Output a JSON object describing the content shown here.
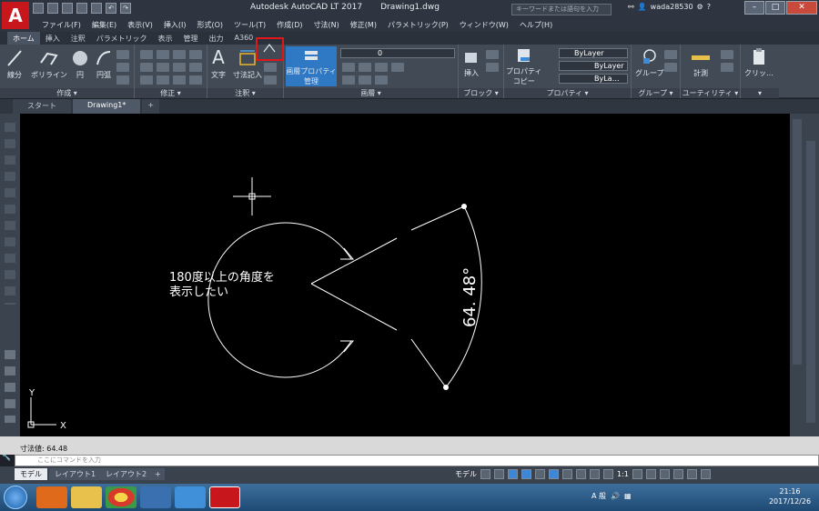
{
  "window": {
    "title": "Autodesk AutoCAD LT 2017",
    "file": "Drawing1.dwg",
    "search_placeholder": "キーワードまたは語句を入力",
    "user": "wada28530",
    "minimize": "–",
    "maximize": "□",
    "close": "✕",
    "logo": "A"
  },
  "menu": [
    "ファイル(F)",
    "編集(E)",
    "表示(V)",
    "挿入(I)",
    "形式(O)",
    "ツール(T)",
    "作成(D)",
    "寸法(N)",
    "修正(M)",
    "パラメトリック(P)",
    "ウィンドウ(W)",
    "ヘルプ(H)"
  ],
  "ribbon_tabs": [
    "ホーム",
    "挿入",
    "注釈",
    "パラメトリック",
    "表示",
    "管理",
    "出力",
    "A360"
  ],
  "ribbon": {
    "draw": {
      "label": "作成 ▾",
      "line": "線分",
      "polyline": "ポリライン",
      "circle": "円",
      "arc": "円弧"
    },
    "modify": {
      "label": "修正 ▾"
    },
    "annotation": {
      "label": "注釈 ▾",
      "text": "文字",
      "dimension": "寸法記入"
    },
    "layers": {
      "label": "画層 ▾",
      "props": "画層プロパティ",
      "props2": "管理",
      "current": "0"
    },
    "block": {
      "label": "ブロック ▾",
      "insert": "挿入"
    },
    "properties": {
      "label": "プロパティ ▾",
      "match": "プロパティ",
      "match2": "コピー",
      "color": "ByLayer",
      "linetype": "ByLayer",
      "lineweight": "ByLa…"
    },
    "groups": {
      "label": "グループ ▾",
      "group": "グループ"
    },
    "utilities": {
      "label": "ユーティリティ ▾",
      "measure": "計測"
    },
    "clipboard": {
      "label": "▾",
      "clip": "クリッ…"
    }
  },
  "doc_tabs": [
    "スタート",
    "Drawing1*"
  ],
  "canvas": {
    "note_line1": "180度以上の角度を",
    "note_line2": "表示したい",
    "dim_text": "64. 48°",
    "ucs_x": "X",
    "ucs_y": "Y"
  },
  "command": {
    "history": "寸法値: 64.48",
    "placeholder": "ここにコマンドを入力"
  },
  "layout_tabs": [
    "モデル",
    "レイアウト1",
    "レイアウト2"
  ],
  "status": {
    "model": "モデル",
    "scale": "1:1"
  },
  "taskbar": {
    "ime": "A 般",
    "date": "2017/12/26",
    "time": "21:16"
  }
}
